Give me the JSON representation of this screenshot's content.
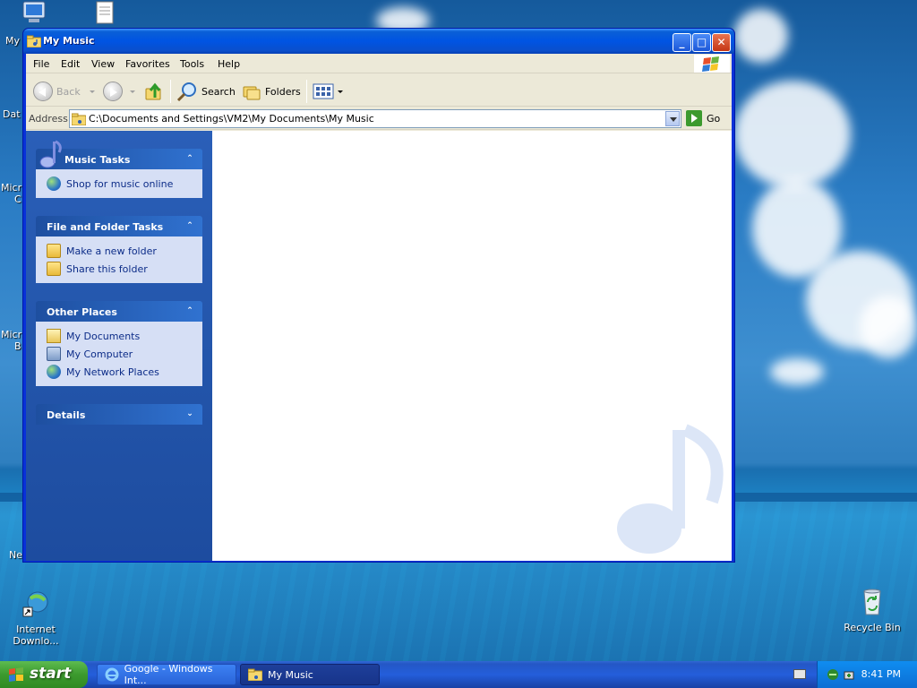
{
  "desktop": {
    "icons": [
      {
        "label": "Internet Downlo..."
      },
      {
        "label": "Recycle Bin"
      }
    ],
    "cut_labels": [
      "My",
      "Dat",
      "Micr",
      "C",
      "Micr",
      "B",
      "Ne"
    ]
  },
  "window": {
    "title": "My Music",
    "menu": [
      "File",
      "Edit",
      "View",
      "Favorites",
      "Tools",
      "Help"
    ],
    "toolbar": {
      "back": "Back",
      "search": "Search",
      "folders": "Folders"
    },
    "address": {
      "label": "Address",
      "value": "C:\\Documents and Settings\\VM2\\My Documents\\My Music",
      "go": "Go"
    },
    "panels": [
      {
        "title": "Music Tasks",
        "items": [
          {
            "label": "Shop for music online",
            "icon": "globe-icon"
          }
        ]
      },
      {
        "title": "File and Folder Tasks",
        "items": [
          {
            "label": "Make a new folder",
            "icon": "new-folder-icon"
          },
          {
            "label": "Share this folder",
            "icon": "share-folder-icon"
          }
        ]
      },
      {
        "title": "Other Places",
        "items": [
          {
            "label": "My Documents",
            "icon": "my-documents-icon"
          },
          {
            "label": "My Computer",
            "icon": "my-computer-icon"
          },
          {
            "label": "My Network Places",
            "icon": "network-places-icon"
          }
        ]
      },
      {
        "title": "Details",
        "items": []
      }
    ]
  },
  "taskbar": {
    "start": "start",
    "tasks": [
      {
        "label": "Google - Windows Int..."
      },
      {
        "label": "My Music"
      }
    ],
    "clock": "8:41 PM"
  },
  "colors": {
    "titlebar": "#0054e3",
    "taskpane": "#2a5fb8",
    "start_button": "#3c9a2e",
    "task_link": "#0c2c88"
  }
}
